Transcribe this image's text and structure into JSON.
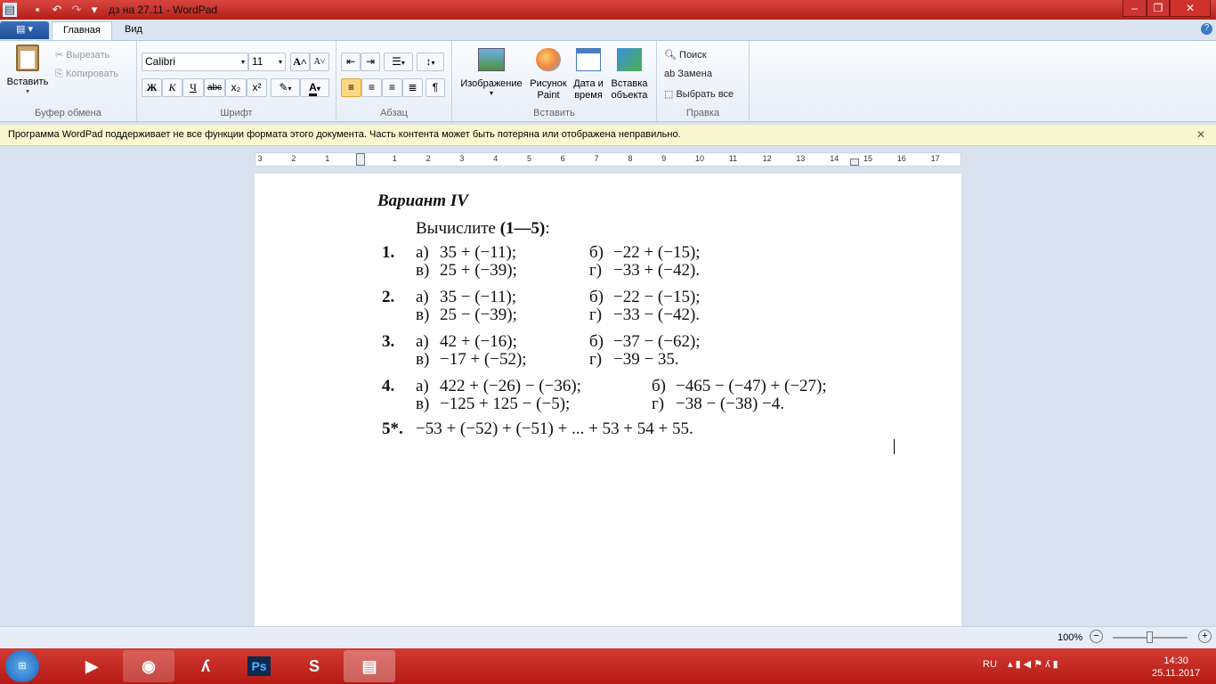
{
  "window": {
    "title": "дз на 27.11 - WordPad"
  },
  "tabs": {
    "file": "▤ ▾",
    "home": "Главная",
    "view": "Вид"
  },
  "clipboard": {
    "paste": "Вставить",
    "cut": "Вырезать",
    "copy": "Копировать",
    "label": "Буфер обмена"
  },
  "font": {
    "name": "Calibri",
    "size": "11",
    "bold": "Ж",
    "italic": "К",
    "underline": "Ч",
    "strike": "abc",
    "sub": "x₂",
    "sup": "x²",
    "grow": "A˄",
    "shrink": "A˅",
    "color": "A",
    "label": "Шрифт"
  },
  "paragraph": {
    "label": "Абзац"
  },
  "insert": {
    "image": "Изображение",
    "paint": "Рисунок Paint",
    "datetime": "Дата и время",
    "object": "Вставка объекта",
    "label": "Вставить"
  },
  "edit": {
    "find": "Поиск",
    "replace": "Замена",
    "select_all": "Выбрать все",
    "label": "Правка"
  },
  "infobar": {
    "text": "Программа WordPad поддерживает не все функции формата этого документа. Часть контента может быть потеряна или отображена неправильно.",
    "close": "✕"
  },
  "ruler": {
    "labels": [
      "3",
      "2",
      "1",
      "1",
      "2",
      "3",
      "4",
      "5",
      "6",
      "7",
      "8",
      "9",
      "10",
      "11",
      "12",
      "13",
      "14",
      "15",
      "16",
      "17"
    ]
  },
  "document": {
    "heading": "Вариант  IV",
    "intro": "Вычислите ",
    "intro_bold": "(1—5)",
    "intro_end": ":",
    "problems": [
      {
        "num": "1.",
        "rows": [
          [
            "а)",
            "35 + (−11);",
            "б)",
            "−22 + (−15);"
          ],
          [
            "в)",
            "25 + (−39);",
            "г)",
            "−33 + (−42)."
          ]
        ]
      },
      {
        "num": "2.",
        "rows": [
          [
            "а)",
            "35 − (−11);",
            "б)",
            "−22 − (−15);"
          ],
          [
            "в)",
            "25 − (−39);",
            "г)",
            "−33 − (−42)."
          ]
        ]
      },
      {
        "num": "3.",
        "rows": [
          [
            "а)",
            "42 + (−16);",
            "б)",
            "−37 − (−62);"
          ],
          [
            "в)",
            "−17 + (−52);",
            "г)",
            "−39 − 35."
          ]
        ]
      },
      {
        "num": "4.",
        "rows": [
          [
            "а)",
            "422 + (−26) − (−36);",
            "б)",
            "−465 − (−47) + (−27);"
          ],
          [
            "в)",
            "−125 + 125 − (−5);",
            "г)",
            "−38 − (−38)  −4."
          ]
        ]
      }
    ],
    "p5_num": "5*.",
    "p5": "−53 + (−52) + (−51) + ... + 53 + 54 + 55."
  },
  "status": {
    "zoom": "100%",
    "zoom_level": 100
  },
  "tray": {
    "lang": "RU",
    "time": "14:30",
    "date": "25.11.2017"
  },
  "colors": {
    "titlebar": "#c0302a",
    "taskbar": "#c42520",
    "infobar": "#fcf6cf"
  }
}
